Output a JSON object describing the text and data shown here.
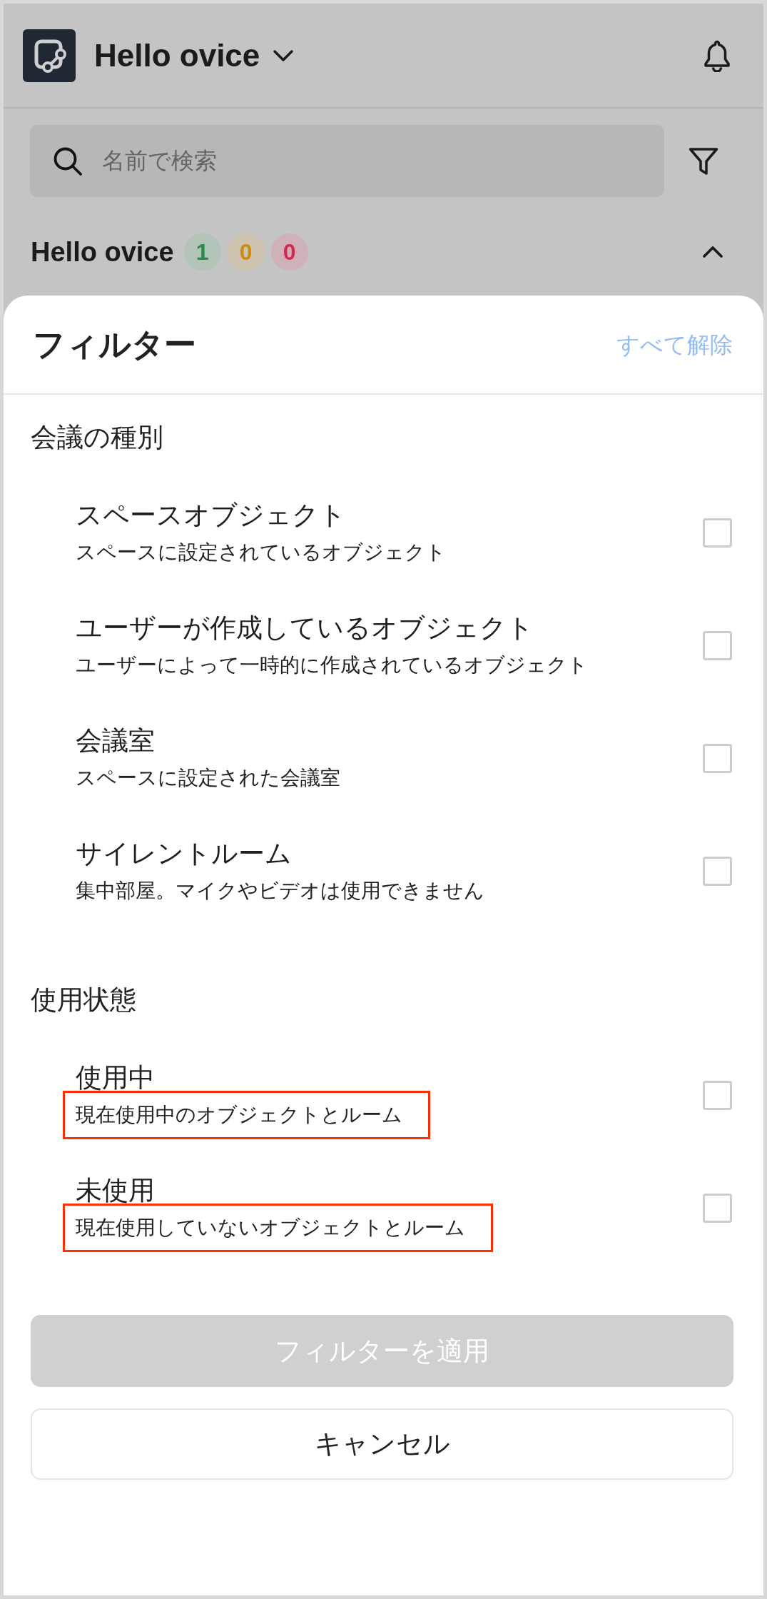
{
  "header": {
    "workspace": "Hello ovice"
  },
  "search": {
    "placeholder": "名前で検索"
  },
  "group": {
    "title": "Hello ovice",
    "expanded": true,
    "badges": [
      {
        "count": "1",
        "color": "#2a8a4c"
      },
      {
        "count": "0",
        "color": "#cc8a14"
      },
      {
        "count": "0",
        "color": "#d42a52"
      }
    ]
  },
  "filter_sheet": {
    "title": "フィルター",
    "clear_all": "すべて解除",
    "sections": [
      {
        "title": "会議の種別",
        "items": [
          {
            "title": "スペースオブジェクト",
            "description": "スペースに設定されているオブジェクト",
            "checked": false,
            "highlighted": false
          },
          {
            "title": "ユーザーが作成しているオブジェクト",
            "description": "ユーザーによって一時的に作成されているオブジェクト",
            "checked": false,
            "highlighted": false
          },
          {
            "title": "会議室",
            "description": "スペースに設定された会議室",
            "checked": false,
            "highlighted": false
          },
          {
            "title": "サイレントルーム",
            "description": "集中部屋。マイクやビデオは使用できません",
            "checked": false,
            "highlighted": false
          }
        ]
      },
      {
        "title": "使用状態",
        "items": [
          {
            "title": "使用中",
            "description": "現在使用中のオブジェクトとルーム",
            "checked": false,
            "highlighted": true
          },
          {
            "title": "未使用",
            "description": "現在使用していないオブジェクトとルーム",
            "checked": false,
            "highlighted": true
          }
        ]
      }
    ],
    "buttons": [
      {
        "kind": "primary",
        "label": "フィルターを適用",
        "disabled": true
      },
      {
        "kind": "secondary",
        "label": "キャンセル",
        "disabled": false
      }
    ]
  }
}
